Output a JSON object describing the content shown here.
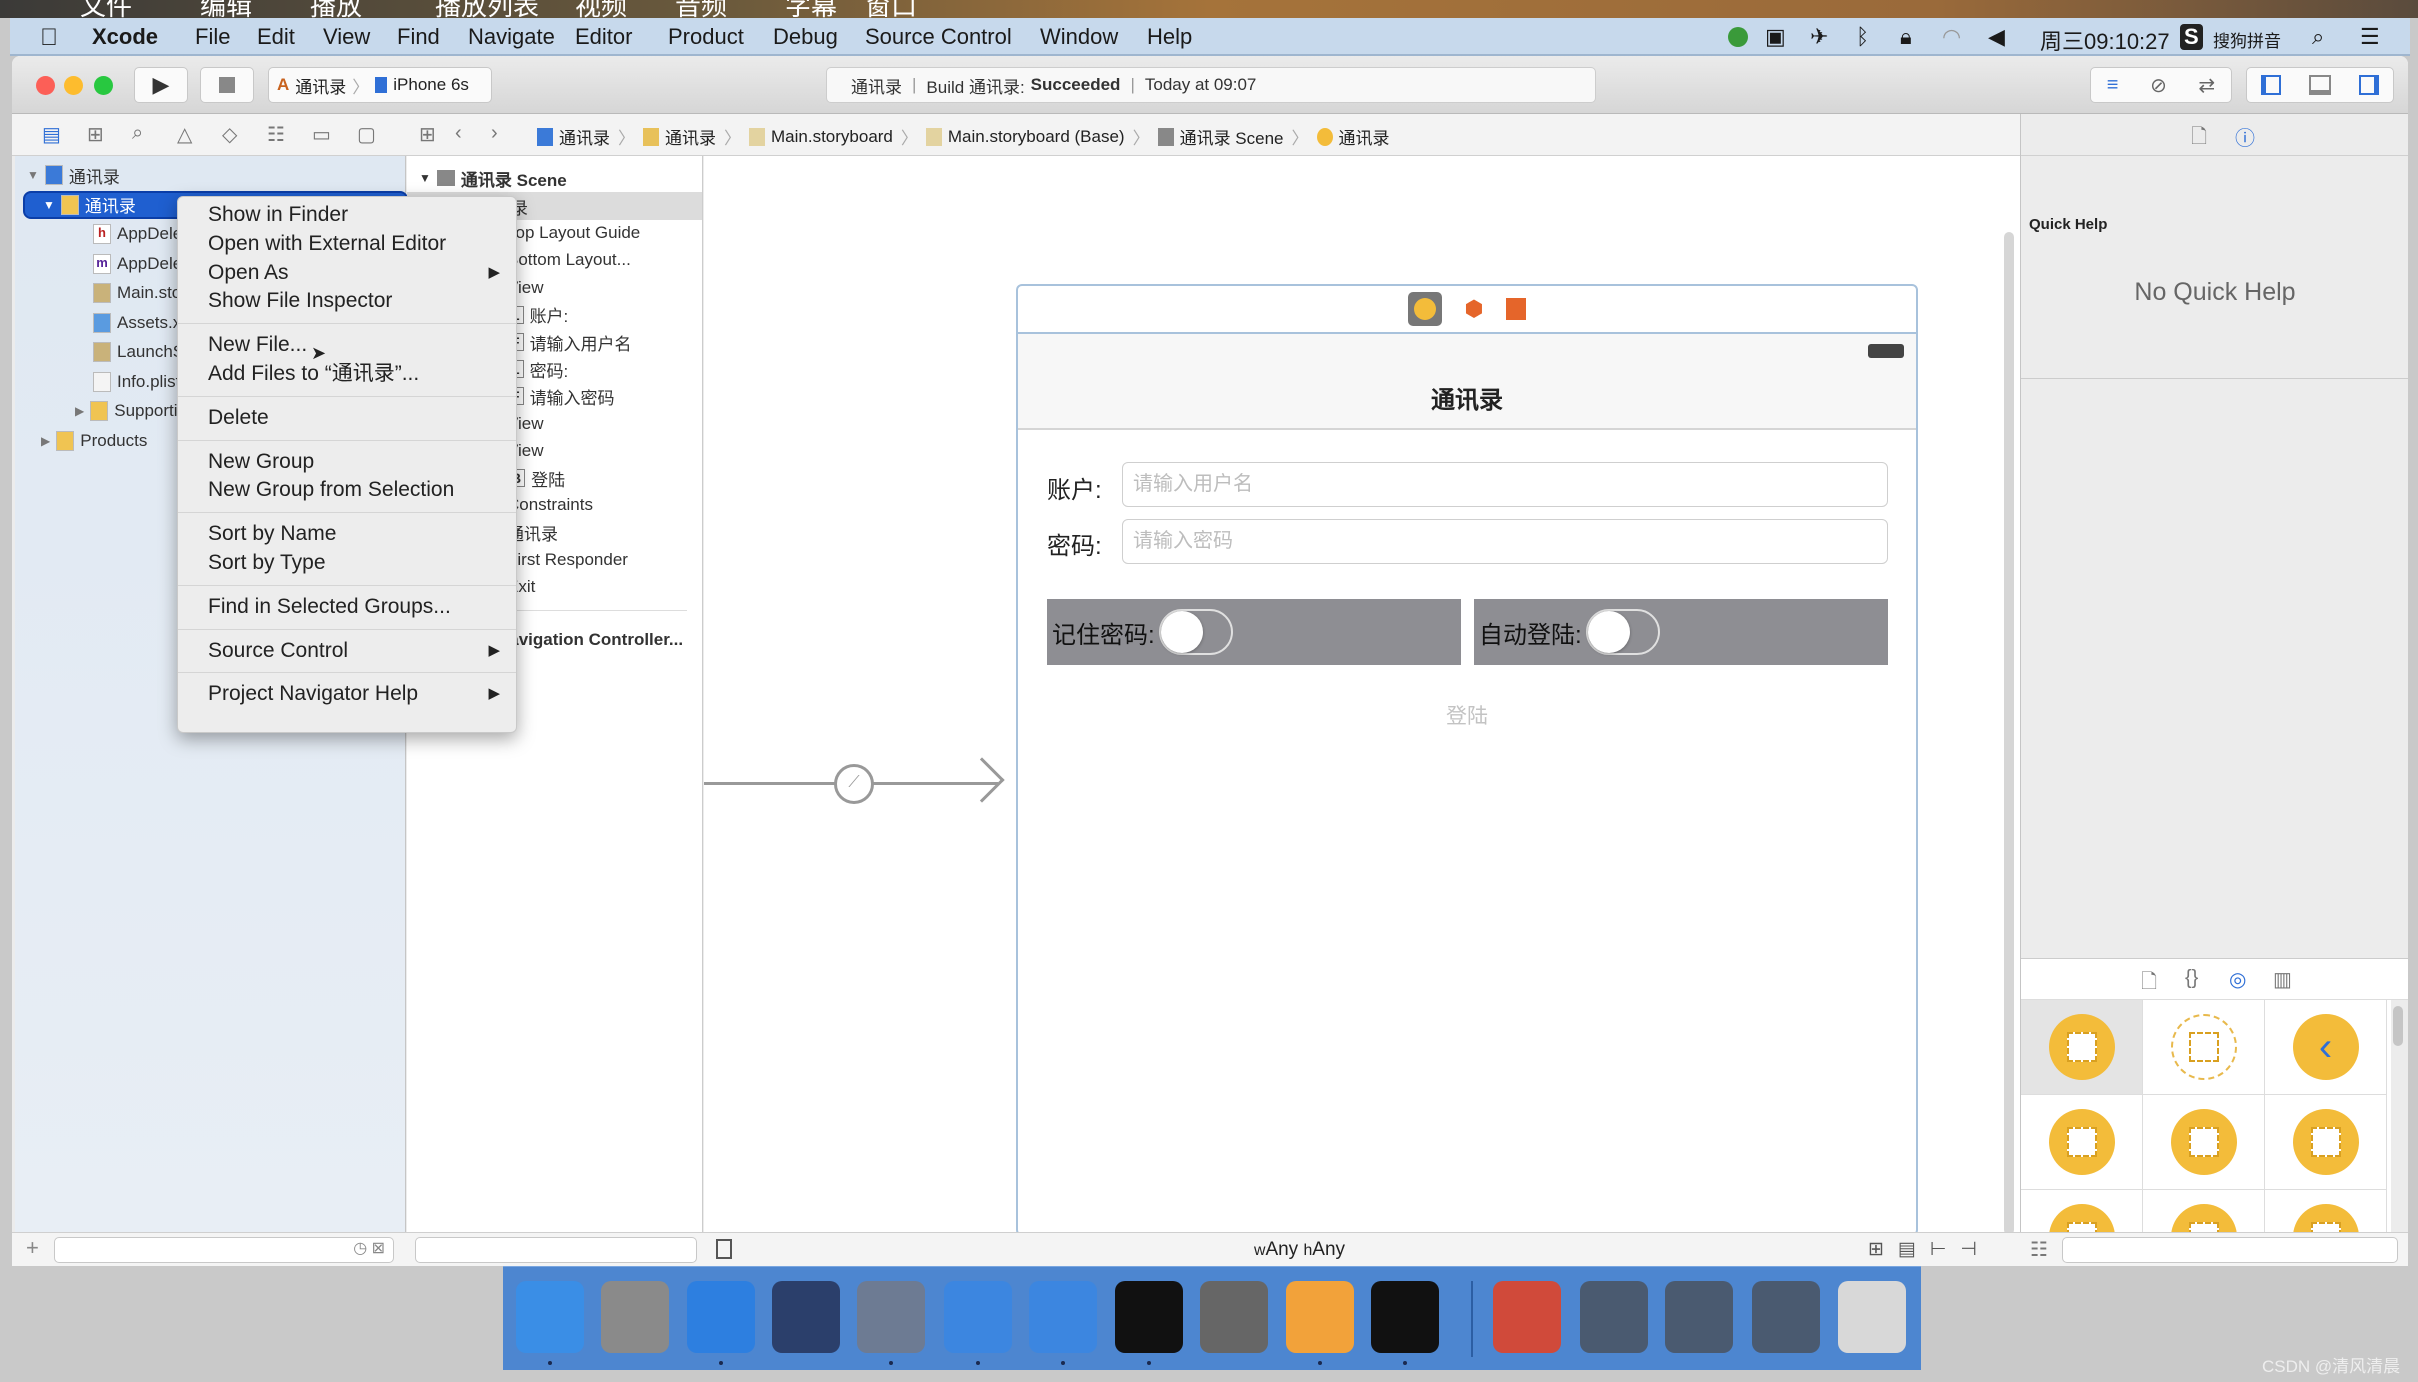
{
  "os_top_strip": {
    "items": [
      "文件",
      "编辑",
      "播放",
      "播放列表",
      "视频",
      "音频",
      "字幕",
      "窗口"
    ]
  },
  "menubar": {
    "app": "Xcode",
    "items": [
      "File",
      "Edit",
      "View",
      "Find",
      "Navigate",
      "Editor",
      "Product",
      "Debug",
      "Source Control",
      "Window",
      "Help"
    ],
    "clock": "周三09:10:27",
    "input_method": "搜狗拼音"
  },
  "toolbar": {
    "scheme": "通讯录",
    "device": "iPhone 6s",
    "status": {
      "project": "通讯录",
      "build_prefix": "Build 通讯录:",
      "build_result": "Succeeded",
      "time": "Today at 09:07"
    }
  },
  "breadcrumb": [
    "通讯录",
    "通讯录",
    "Main.storyboard",
    "Main.storyboard (Base)",
    "通讯录 Scene",
    "通讯录"
  ],
  "navigator": {
    "items": [
      {
        "label": "通讯录",
        "icon": "project-icon",
        "level": 0,
        "disclosure": "open"
      },
      {
        "label": "通讯录",
        "icon": "folder-icon",
        "level": 1,
        "disclosure": "open",
        "selected": true
      },
      {
        "label": "AppDelegate.h",
        "icon": "h-file-icon",
        "level": 2
      },
      {
        "label": "AppDelegate.m",
        "icon": "m-file-icon",
        "level": 2
      },
      {
        "label": "Main.storyboard",
        "icon": "storyboard-icon",
        "level": 2
      },
      {
        "label": "Assets.xcassets",
        "icon": "assets-icon",
        "level": 2
      },
      {
        "label": "LaunchScreen.storyboard",
        "icon": "storyboard-icon",
        "level": 2
      },
      {
        "label": "Info.plist",
        "icon": "plist-icon",
        "level": 2
      },
      {
        "label": "Supporting Files",
        "icon": "folder-icon",
        "level": 2,
        "disclosure": "closed"
      },
      {
        "label": "Products",
        "icon": "folder-icon",
        "level": 1,
        "disclosure": "closed"
      }
    ]
  },
  "outline": {
    "scene": "通讯录 Scene",
    "items": [
      {
        "badge": "",
        "label": "通讯录"
      },
      {
        "badge": "",
        "label": "Top Layout Guide"
      },
      {
        "badge": "",
        "label": "Bottom Layout..."
      },
      {
        "badge": "",
        "label": "View"
      },
      {
        "badge": "L",
        "label": "账户:"
      },
      {
        "badge": "F",
        "label": "请输入用户名"
      },
      {
        "badge": "L",
        "label": "密码:"
      },
      {
        "badge": "F",
        "label": "请输入密码"
      },
      {
        "badge": "",
        "label": "View"
      },
      {
        "badge": "",
        "label": "View"
      },
      {
        "badge": "B",
        "label": "登陆"
      },
      {
        "badge": "",
        "label": "Constraints"
      },
      {
        "badge": "",
        "label": "通讯录"
      },
      {
        "badge": "",
        "label": "First Responder"
      },
      {
        "badge": "",
        "label": "Exit"
      }
    ],
    "next_scene": "Navigation Controller..."
  },
  "context_menu": {
    "groups": [
      [
        {
          "label": "Show in Finder"
        },
        {
          "label": "Open with External Editor"
        },
        {
          "label": "Open As",
          "submenu": true
        },
        {
          "label": "Show File Inspector"
        }
      ],
      [
        {
          "label": "New File..."
        },
        {
          "label": "Add Files to “通讯录”..."
        }
      ],
      [
        {
          "label": "Delete"
        }
      ],
      [
        {
          "label": "New Group"
        },
        {
          "label": "New Group from Selection"
        }
      ],
      [
        {
          "label": "Sort by Name"
        },
        {
          "label": "Sort by Type"
        }
      ],
      [
        {
          "label": "Find in Selected Groups..."
        }
      ],
      [
        {
          "label": "Source Control",
          "submenu": true
        }
      ],
      [
        {
          "label": "Project Navigator Help",
          "submenu": true
        }
      ]
    ]
  },
  "scene": {
    "nav_title": "通讯录",
    "account_label": "账户:",
    "account_placeholder": "请输入用户名",
    "password_label": "密码:",
    "password_placeholder": "请输入密码",
    "remember_label": "记住密码:",
    "remember_on": false,
    "autologin_label": "自动登陆:",
    "autologin_on": false,
    "login_button": "登陆"
  },
  "canvas_footer": {
    "w_prefix": "w",
    "w_value": "Any",
    "h_prefix": "h",
    "h_value": "Any"
  },
  "inspector": {
    "title": "Quick Help",
    "empty": "No Quick Help"
  },
  "library": {
    "items": [
      "view-controller-icon",
      "storyboard-reference-icon",
      "navigation-controller-icon",
      "table-view-controller-icon",
      "collection-view-controller-icon",
      "tab-bar-controller-icon",
      "split-view-controller-icon",
      "page-view-controller-icon",
      "glkit-view-controller-icon"
    ]
  },
  "dock": {
    "items": [
      "finder",
      "launchpad",
      "safari",
      "mouse",
      "photo-booth",
      "xcode",
      "simulator",
      "terminal",
      "system-preferences",
      "sketch",
      "exec",
      "quicktime",
      "screen-1",
      "screen-2",
      "screen-3",
      "trash"
    ]
  },
  "watermark": "CSDN @清风清晨",
  "colors": {
    "accent": "#2f6fd6",
    "library_yellow": "#f3bc3a",
    "dock": "#4d86d0",
    "menubar": "#c7d9ec"
  }
}
